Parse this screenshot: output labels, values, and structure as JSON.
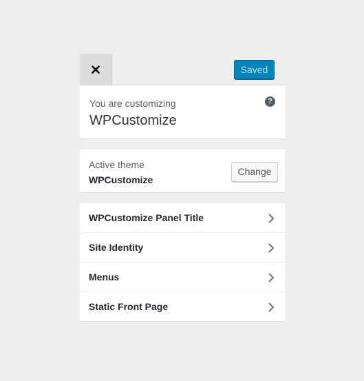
{
  "header": {
    "close_icon": "close-icon",
    "saved_label": "Saved",
    "saved_color": "#0085ba"
  },
  "info": {
    "label": "You are customizing",
    "title": "WPCustomize",
    "help_icon": "question-icon",
    "help_glyph": "?"
  },
  "theme": {
    "label": "Active theme",
    "name": "WPCustomize",
    "change_label": "Change"
  },
  "sections": [
    {
      "label": "WPCustomize Panel Title",
      "icon": "chevron-right-icon"
    },
    {
      "label": "Site Identity",
      "icon": "chevron-right-icon"
    },
    {
      "label": "Menus",
      "icon": "chevron-right-icon"
    },
    {
      "label": "Static Front Page",
      "icon": "chevron-right-icon"
    }
  ]
}
